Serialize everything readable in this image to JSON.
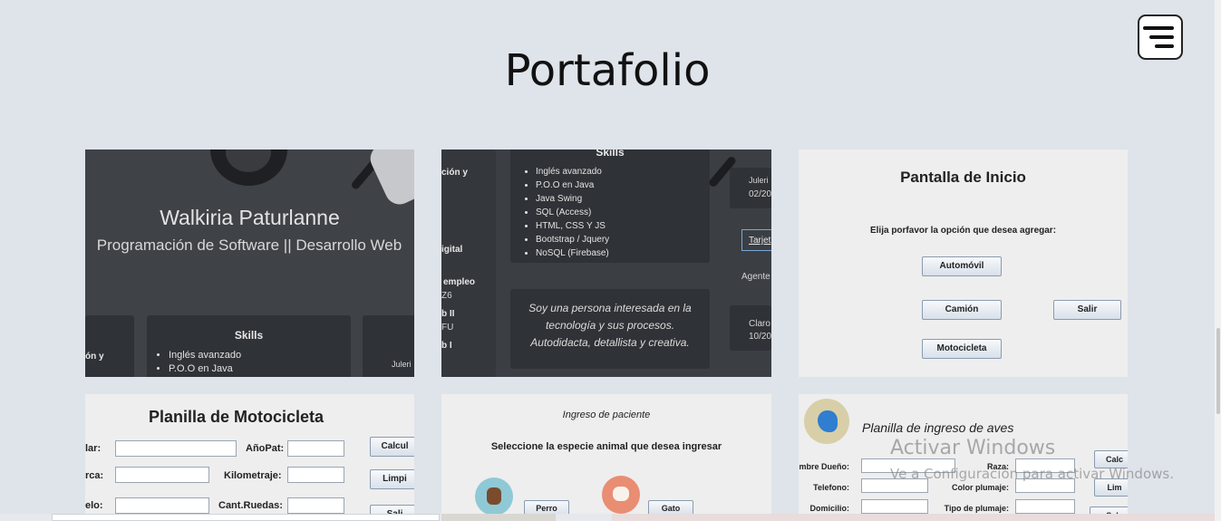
{
  "page": {
    "title": "Portafolio"
  },
  "menu": {
    "icon": "hamburger-menu-icon"
  },
  "portfolio": {
    "card1": {
      "name": "Walkiria Paturlanne",
      "subtitle": "Programación de Software || Desarrollo Web",
      "skills_heading": "Skills",
      "skills": [
        "Inglés avanzado",
        "P.O.O en Java"
      ],
      "left_fragment": "ón y",
      "right_fragment": "Juleri"
    },
    "card2": {
      "skills_heading": "Skills",
      "skills": [
        "Inglés avanzado",
        "P.O.O en Java",
        "Java Swing",
        "SQL (Access)",
        "HTML, CSS Y JS",
        "Bootstrap / Jquery",
        "NoSQL (Firebase)"
      ],
      "left_fragments": [
        "ción y",
        "igital",
        "empleo",
        "Z6",
        "b II",
        "FU",
        "b I"
      ],
      "right_fragments": [
        "Juleri",
        "02/20",
        "Tarjet",
        "Agente",
        "Claro",
        "10/20"
      ],
      "quote": "Soy una persona interesada en la tecnología y sus procesos. Autodidacta, detallista y creativa."
    },
    "card3": {
      "title": "Pantalla de Inicio",
      "prompt": "Elija porfavor la opción que desea agregar:",
      "buttons": {
        "auto": "Automóvil",
        "camion": "Camión",
        "salir": "Salir",
        "moto": "Motocicleta"
      }
    },
    "card4": {
      "title": "Planilla de Motocicleta",
      "labels": [
        "lar:",
        "rca:",
        "elo:"
      ],
      "right_labels": [
        "AñoPat:",
        "Kilometraje:",
        "Cant.Ruedas:"
      ],
      "buttons": [
        "Calcul",
        "Limpi",
        "Sali"
      ]
    },
    "card5": {
      "title": "Ingreso de paciente",
      "prompt": "Seleccione la especie animal que desea ingresar",
      "buttons": [
        "Perro",
        "Gato"
      ]
    },
    "card6": {
      "title": "Planilla de ingreso de aves",
      "labels": [
        "mbre Dueño:",
        "Telefono:",
        "Domicilio:"
      ],
      "right_labels": [
        "Raza:",
        "Color plumaje:",
        "Tipo de plumaje:"
      ],
      "buttons": [
        "Calc",
        "Lim",
        "Sal"
      ]
    }
  },
  "watermark": {
    "line1": "Activar Windows",
    "line2": "Ve a Configuración para activar Windows."
  }
}
